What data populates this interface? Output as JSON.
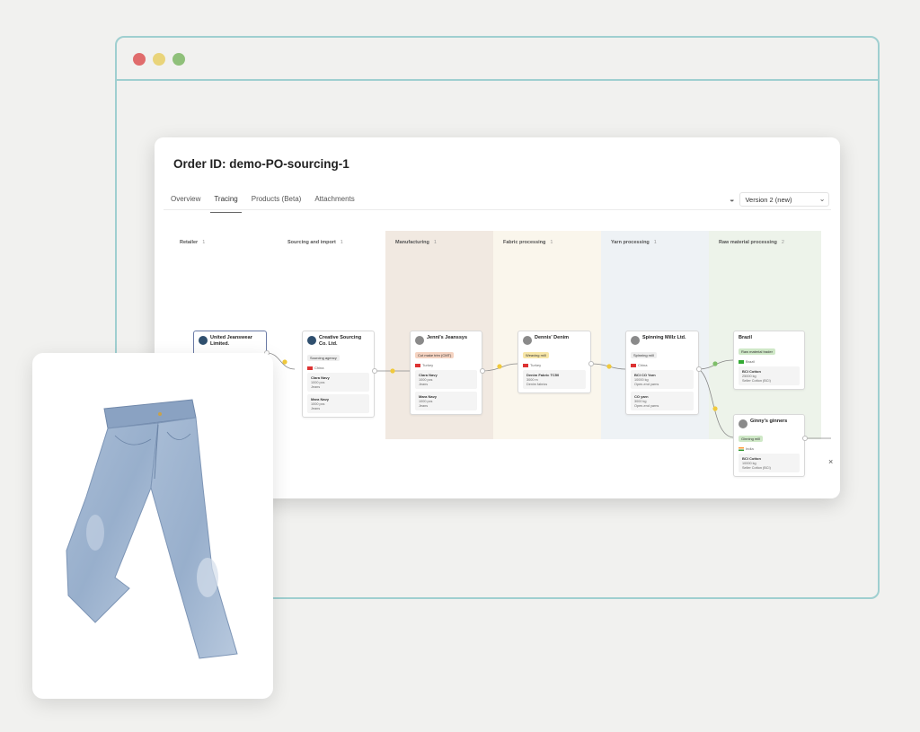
{
  "order": {
    "title": "Order ID: demo-PO-sourcing-1"
  },
  "tabs": [
    "Overview",
    "Tracing",
    "Products (Beta)",
    "Attachments"
  ],
  "active_tab": "Tracing",
  "version": {
    "label": "Version 2 (new)",
    "icon": "version-icon"
  },
  "columns": [
    {
      "label": "Retailer",
      "count": "1"
    },
    {
      "label": "Sourcing and import",
      "count": "1"
    },
    {
      "label": "Manufacturing",
      "count": "1"
    },
    {
      "label": "Fabric processing",
      "count": "1"
    },
    {
      "label": "Yarn processing",
      "count": "1"
    },
    {
      "label": "Raw material processing",
      "count": "2"
    }
  ],
  "nodes": {
    "retailer": {
      "name": "United Jeanswear Limited.",
      "tag": "Brand",
      "location": "United States of America"
    },
    "sourcing": {
      "name": "Creative Sourcing Co. Ltd.",
      "tag": "Sourcing agency",
      "location": "China",
      "items": [
        {
          "name": "Clara Navy",
          "qty": "1000  pcs",
          "desc": "Jeans"
        },
        {
          "name": "Mara Navy",
          "qty": "1000  pcs",
          "desc": "Jeans"
        }
      ]
    },
    "manufacturing": {
      "name": "Jenni's Jeanssys",
      "tag": "Cut make trim (CMT)",
      "location": "Turkey",
      "items": [
        {
          "name": "Clara Navy",
          "qty": "1000  pcs",
          "desc": "Jeans"
        },
        {
          "name": "Mara Navy",
          "qty": "1000  pcs",
          "desc": "Jeans"
        }
      ]
    },
    "fabric": {
      "name": "Dennis' Denim",
      "tag": "Weaving mill",
      "location": "Turkey",
      "items": [
        {
          "name": "Denim Fabric TC50",
          "qty": "3000  m",
          "desc": "Denim fabrics"
        }
      ]
    },
    "yarn": {
      "name": "Spinning Millz Ltd.",
      "tag": "Spinning mill",
      "location": "China",
      "items": [
        {
          "name": "BCI CO Yarn",
          "qty": "10000  kg",
          "desc": "Open-end yarns"
        },
        {
          "name": "CO yarn",
          "qty": "3000  kg",
          "desc": "Open-end yarns"
        }
      ]
    },
    "raw_brazil": {
      "name": "Brazil",
      "tag": "Raw material trader",
      "location": "Brazil",
      "items": [
        {
          "name": "BCI Cotton",
          "qty": "25000  kg",
          "desc": "Seller Cotton (BCI)"
        }
      ]
    },
    "raw_ginny": {
      "name": "Ginny's ginners",
      "tag": "Ginning mill",
      "location": "India",
      "items": [
        {
          "name": "BCI Cotton",
          "qty": "10000  kg",
          "desc": "Seller Cotton (BCI)"
        }
      ]
    }
  },
  "close_label": "×",
  "colors": {
    "frame": "#9fcfd0",
    "dot_red": "#e06c6c",
    "dot_yellow": "#e9d47a",
    "dot_green": "#8fc07a",
    "edge_yellow": "#f0c93c",
    "edge_green": "#7fbf6a"
  }
}
